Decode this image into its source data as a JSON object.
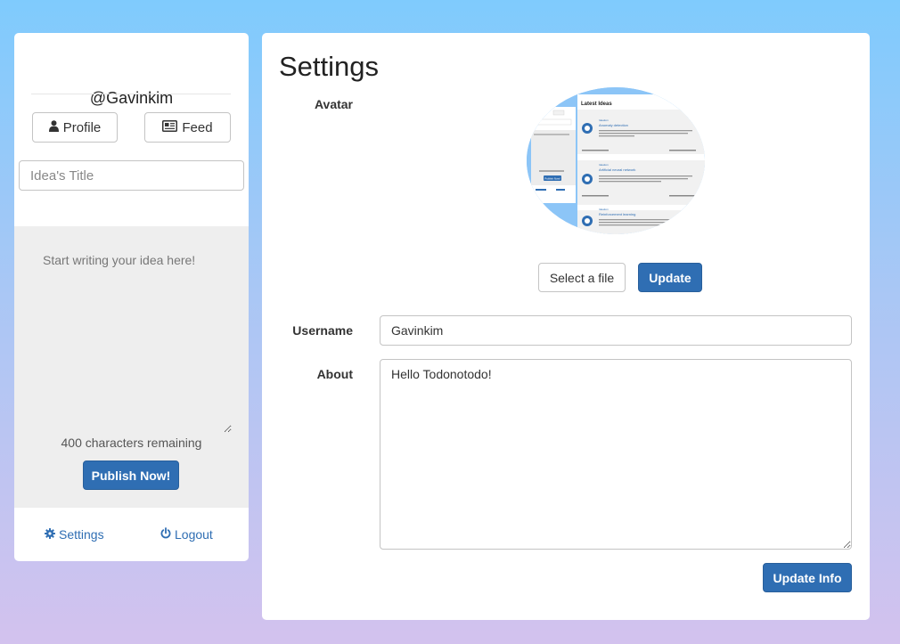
{
  "sidebar": {
    "handle": "@Gavinkim",
    "profile_label": "Profile",
    "feed_label": "Feed",
    "title_placeholder": "Idea's Title",
    "idea_placeholder": "Start writing your idea here!",
    "chars_remaining": "400 characters remaining",
    "publish_label": "Publish Now!",
    "settings_label": "Settings",
    "logout_label": "Logout",
    "icons": {
      "profile": "user-icon",
      "feed": "newspaper-icon",
      "settings": "gear-icon",
      "logout": "power-icon"
    }
  },
  "main": {
    "title": "Settings",
    "avatar_label": "Avatar",
    "avatar_image": {
      "heading": "Latest Ideas",
      "mini_button": "Publish Now!",
      "items": [
        {
          "category": "Ideation",
          "title": "Anomaly detection"
        },
        {
          "category": "Ideation",
          "title": "Artificial neural network"
        },
        {
          "category": "Ideation",
          "title": "Reinforcement learning"
        }
      ]
    },
    "select_file_label": "Select a file",
    "update_label": "Update",
    "username_label": "Username",
    "username_value": "Gavinkim",
    "about_label": "About",
    "about_value": "Hello Todonotodo!",
    "update_info_label": "Update Info"
  },
  "colors": {
    "primary": "#2f6eb3",
    "bg_top": "#7fcbfd",
    "bg_bottom": "#d3c2ee",
    "editor_bg": "#eeeeee"
  }
}
